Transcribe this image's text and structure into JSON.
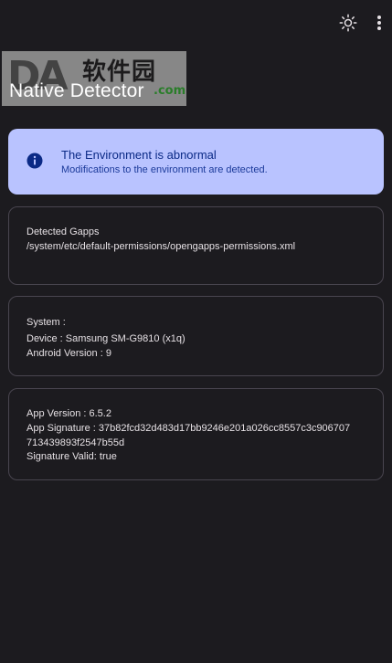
{
  "app": {
    "title": "Native Detector"
  },
  "watermark": {
    "logo": "DA",
    "cn": "软件园",
    "com": ".com"
  },
  "toolbar": {
    "theme_icon": "brightness-icon",
    "more_icon": "more-vert-icon"
  },
  "alert": {
    "icon": "info-icon",
    "title": "The Environment is abnormal",
    "subtitle": "Modifications to the environment are detected.",
    "bg_color": "#b9c3ff",
    "text_color": "#0b2a86"
  },
  "gapps": {
    "heading": "Detected Gapps",
    "path": "/system/etc/default-permissions/opengapps-permissions.xml"
  },
  "system": {
    "heading": "System :",
    "device": "Device : Samsung SM-G9810  (x1q)",
    "android": "Android Version : 9"
  },
  "app_info": {
    "version": "App Version : 6.5.2",
    "signature_line1": "App Signature : 37b82fcd32d483d17bb9246e201a026cc8557c3c906707",
    "signature_line2": "713439893f2547b55d",
    "valid": "Signature Valid: true"
  }
}
